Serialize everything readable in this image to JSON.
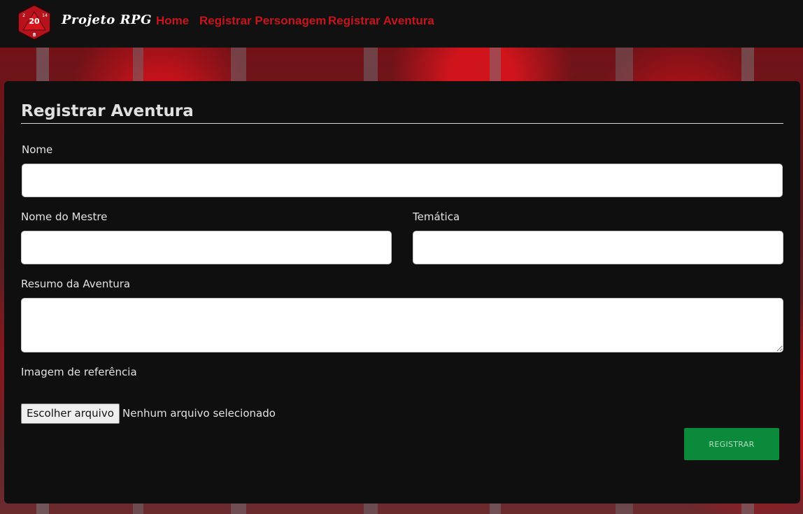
{
  "nav": {
    "brand": "Projeto RPG",
    "logo_numbers": [
      "20",
      "2",
      "14",
      "8"
    ],
    "links": [
      "Home",
      "Registrar Personagem",
      "Registrar Aventura"
    ]
  },
  "form": {
    "title": "Registrar Aventura",
    "fields": {
      "nome": {
        "label": "Nome",
        "value": ""
      },
      "mestre": {
        "label": "Nome do Mestre",
        "value": ""
      },
      "tematica": {
        "label": "Temática",
        "value": ""
      },
      "resumo": {
        "label": "Resumo da Aventura",
        "value": ""
      },
      "imagem": {
        "label": "Imagem de referência",
        "button": "Escolher arquivo",
        "status": "Nenhum arquivo selecionado"
      }
    },
    "submit": "REGISTRAR"
  },
  "colors": {
    "navbar": "#111111",
    "link": "#c8141c",
    "card": "#0f0f0f",
    "submit": "#0a8a3a"
  }
}
